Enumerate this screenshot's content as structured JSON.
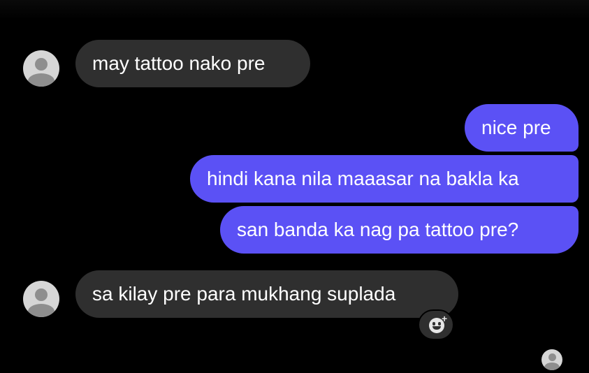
{
  "conversation": {
    "messages": [
      {
        "direction": "incoming",
        "text": "may tattoo nako pre"
      },
      {
        "direction": "outgoing",
        "text": "nice pre"
      },
      {
        "direction": "outgoing",
        "text": "hindi kana nila maaasar na bakla ka"
      },
      {
        "direction": "outgoing",
        "text": "san banda ka nag pa tattoo pre?"
      },
      {
        "direction": "incoming",
        "text": "sa kilay pre para mukhang suplada"
      }
    ],
    "reaction_button": {
      "icon": "smiley-plus-icon",
      "symbol": "+"
    },
    "read_receipt": {
      "icon": "seen-avatar-icon"
    }
  },
  "colors": {
    "background": "#000000",
    "incoming_bubble": "#2f2f2f",
    "outgoing_bubble": "#5b51f5",
    "text": "#ffffff"
  }
}
